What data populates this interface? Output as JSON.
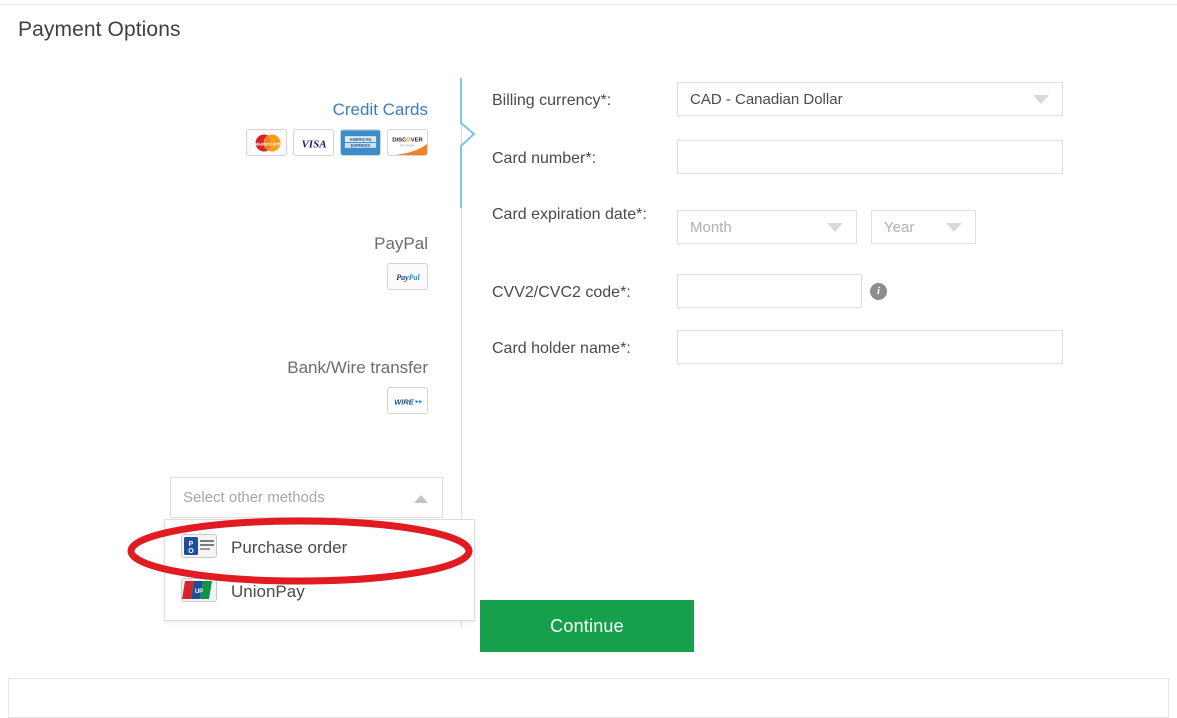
{
  "page": {
    "title": "Payment Options"
  },
  "methods": [
    {
      "id": "credit-cards",
      "label": "Credit Cards",
      "active": true,
      "logos": [
        "mastercard-logo",
        "visa-logo",
        "amex-logo",
        "discover-logo"
      ]
    },
    {
      "id": "paypal",
      "label": "PayPal",
      "active": false,
      "logos": [
        "paypal-logo"
      ]
    },
    {
      "id": "bank-wire-transfer",
      "label": "Bank/Wire transfer",
      "active": false,
      "logos": [
        "wire-logo"
      ]
    }
  ],
  "other_methods": {
    "placeholder": "Select other methods",
    "expanded": true,
    "chevron_icon": "chevron-up-icon",
    "options": [
      {
        "label": "Purchase order",
        "icon": "purchase-order-icon",
        "highlighted": true
      },
      {
        "label": "UnionPay",
        "icon": "unionpay-icon",
        "highlighted": false
      }
    ]
  },
  "annotation": {
    "shape": "ellipse",
    "color": "#e01b22",
    "targets": "Purchase order"
  },
  "form": {
    "fields": [
      {
        "id": "billing-currency",
        "label": "Billing currency*:",
        "type": "select",
        "value": "CAD - Canadian Dollar",
        "is_placeholder": false,
        "icon": "chevron-down-icon"
      },
      {
        "id": "card-number",
        "label": "Card number*:",
        "type": "text",
        "value": ""
      },
      {
        "id": "card-expiration-date",
        "label": "Card expiration date*:",
        "type": "select-pair",
        "month": {
          "value": "Month",
          "is_placeholder": true
        },
        "year": {
          "value": "Year",
          "is_placeholder": true
        }
      },
      {
        "id": "cvv2-cvc2-code",
        "label": "CVV2/CVC2 code*:",
        "type": "text",
        "value": "",
        "hint_icon": "info-icon",
        "hint_glyph": "i"
      },
      {
        "id": "card-holder-name",
        "label": "Card holder name*:",
        "type": "text",
        "value": ""
      }
    ]
  },
  "actions": {
    "continue_label": "Continue"
  },
  "colors": {
    "accent_blue": "#3f7cc0",
    "divider_blue": "#7ec4ea",
    "continue_green": "#17a04b",
    "annotation_red": "#e01b22",
    "label_gray": "#6c6c6c",
    "placeholder_gray": "#b0b0b0"
  }
}
